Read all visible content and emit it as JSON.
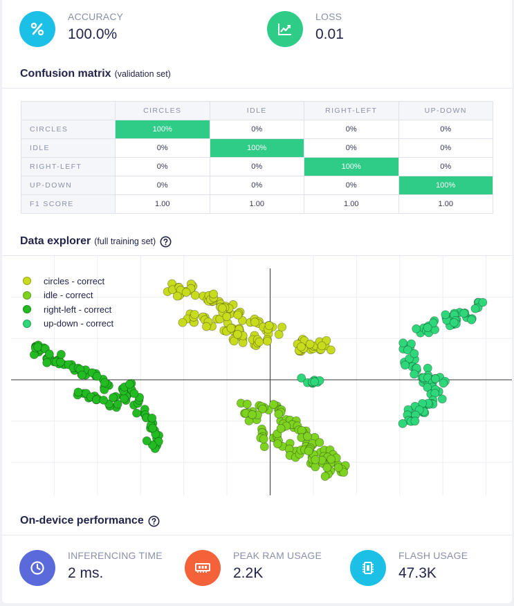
{
  "metrics": {
    "accuracy": {
      "label": "ACCURACY",
      "value": "100.0%",
      "icon": "percent-icon",
      "color": "#1cc0e6"
    },
    "loss": {
      "label": "LOSS",
      "value": "0.01",
      "icon": "trend-chart-icon",
      "color": "#2ecc87"
    }
  },
  "confusion": {
    "title": "Confusion matrix",
    "subtitle": "(validation set)",
    "columns": [
      "CIRCLES",
      "IDLE",
      "RIGHT-LEFT",
      "UP-DOWN"
    ],
    "rows": [
      {
        "label": "CIRCLES",
        "cells": [
          "100%",
          "0%",
          "0%",
          "0%"
        ]
      },
      {
        "label": "IDLE",
        "cells": [
          "0%",
          "100%",
          "0%",
          "0%"
        ]
      },
      {
        "label": "RIGHT-LEFT",
        "cells": [
          "0%",
          "0%",
          "100%",
          "0%"
        ]
      },
      {
        "label": "UP-DOWN",
        "cells": [
          "0%",
          "0%",
          "0%",
          "100%"
        ]
      }
    ],
    "f1": {
      "label": "F1 SCORE",
      "cells": [
        "1.00",
        "1.00",
        "1.00",
        "1.00"
      ]
    },
    "highlight_color": "#2ecc87"
  },
  "explorer": {
    "title": "Data explorer",
    "subtitle": "(full training set)",
    "legend": [
      {
        "label": "circles - correct",
        "color": "#c8dc1e"
      },
      {
        "label": "idle - correct",
        "color": "#7ed321"
      },
      {
        "label": "right-left - correct",
        "color": "#22bb22"
      },
      {
        "label": "up-down - correct",
        "color": "#2ed87a"
      }
    ]
  },
  "chart_data": {
    "type": "scatter",
    "grid": true,
    "legend_position": "top-left",
    "xlim": [
      -6,
      5.6
    ],
    "ylim": [
      -2.8,
      3.0
    ],
    "series": [
      {
        "name": "circles - correct",
        "color": "#c8dc1e",
        "points": [
          [
            -2.2,
            2.25
          ],
          [
            -1.9,
            2.2
          ],
          [
            -1.6,
            2.05
          ],
          [
            -1.3,
            1.85
          ],
          [
            -1.0,
            1.7
          ],
          [
            -0.7,
            1.55
          ],
          [
            -0.4,
            1.4
          ],
          [
            -0.1,
            1.25
          ],
          [
            0.1,
            1.2
          ],
          [
            -1.9,
            1.5
          ],
          [
            -1.6,
            1.45
          ],
          [
            -1.3,
            1.4
          ],
          [
            -0.9,
            1.3
          ],
          [
            -0.7,
            1.05
          ],
          [
            -0.5,
            0.95
          ],
          [
            -0.2,
            0.95
          ],
          [
            -0.8,
            1.2
          ],
          [
            -1.1,
            1.65
          ],
          [
            -1.4,
            1.95
          ],
          [
            -2.0,
            2.1
          ],
          [
            0.6,
            0.8
          ],
          [
            0.9,
            0.85
          ],
          [
            1.1,
            0.8
          ],
          [
            1.3,
            0.85
          ],
          [
            0.75,
            0.75
          ]
        ]
      },
      {
        "name": "idle - correct",
        "color": "#7ed321",
        "points": [
          [
            -0.5,
            -0.7
          ],
          [
            -0.2,
            -0.65
          ],
          [
            0.1,
            -0.6
          ],
          [
            0.3,
            -0.9
          ],
          [
            0.5,
            -1.1
          ],
          [
            0.7,
            -1.3
          ],
          [
            0.9,
            -1.5
          ],
          [
            1.1,
            -1.65
          ],
          [
            1.3,
            -1.8
          ],
          [
            1.5,
            -2.0
          ],
          [
            1.6,
            -2.2
          ],
          [
            -0.3,
            -1.3
          ],
          [
            0.0,
            -1.5
          ],
          [
            0.3,
            -1.6
          ],
          [
            0.6,
            -1.8
          ],
          [
            0.9,
            -1.9
          ],
          [
            1.2,
            -2.05
          ],
          [
            1.45,
            -2.25
          ],
          [
            0.2,
            -1.2
          ],
          [
            -0.4,
            -0.9
          ],
          [
            0.8,
            -1.6
          ]
        ]
      },
      {
        "name": "right-left - correct",
        "color": "#22bb22",
        "points": [
          [
            -5.5,
            0.75
          ],
          [
            -5.2,
            0.6
          ],
          [
            -4.9,
            0.45
          ],
          [
            -4.6,
            0.3
          ],
          [
            -4.3,
            0.15
          ],
          [
            -4.0,
            0.05
          ],
          [
            -3.7,
            -0.15
          ],
          [
            -3.4,
            -0.3
          ],
          [
            -3.2,
            -0.55
          ],
          [
            -3.0,
            -0.8
          ],
          [
            -2.8,
            -1.05
          ],
          [
            -2.7,
            -1.3
          ],
          [
            -2.75,
            -1.55
          ],
          [
            -4.3,
            -0.35
          ],
          [
            -4.0,
            -0.45
          ],
          [
            -3.7,
            -0.55
          ],
          [
            -5.3,
            0.7
          ],
          [
            -5.0,
            0.5
          ],
          [
            -3.5,
            -0.4
          ],
          [
            -3.3,
            -0.2
          ]
        ]
      },
      {
        "name": "up-down - correct",
        "color": "#2ed87a",
        "points": [
          [
            3.2,
            0.85
          ],
          [
            3.5,
            1.15
          ],
          [
            3.8,
            1.3
          ],
          [
            4.1,
            1.4
          ],
          [
            4.4,
            1.5
          ],
          [
            4.6,
            1.55
          ],
          [
            4.8,
            1.85
          ],
          [
            3.2,
            0.55
          ],
          [
            3.3,
            0.3
          ],
          [
            3.5,
            0.15
          ],
          [
            3.7,
            0.0
          ],
          [
            3.8,
            -0.2
          ],
          [
            3.85,
            -0.45
          ],
          [
            3.7,
            -0.65
          ],
          [
            3.5,
            -0.75
          ],
          [
            3.3,
            -0.85
          ],
          [
            3.2,
            -0.95
          ],
          [
            3.95,
            0.0
          ],
          [
            0.9,
            0.0
          ],
          [
            1.15,
            -0.05
          ],
          [
            4.2,
            1.45
          ]
        ]
      }
    ]
  },
  "performance": {
    "title": "On-device performance",
    "items": [
      {
        "label": "INFERENCING TIME",
        "value": "2 ms.",
        "icon": "clock-icon",
        "color": "#5a6adb"
      },
      {
        "label": "PEAK RAM USAGE",
        "value": "2.2K",
        "icon": "ram-chip-icon",
        "color": "#f4623a"
      },
      {
        "label": "FLASH USAGE",
        "value": "47.3K",
        "icon": "flash-chip-icon",
        "color": "#1cc0e6"
      }
    ]
  }
}
